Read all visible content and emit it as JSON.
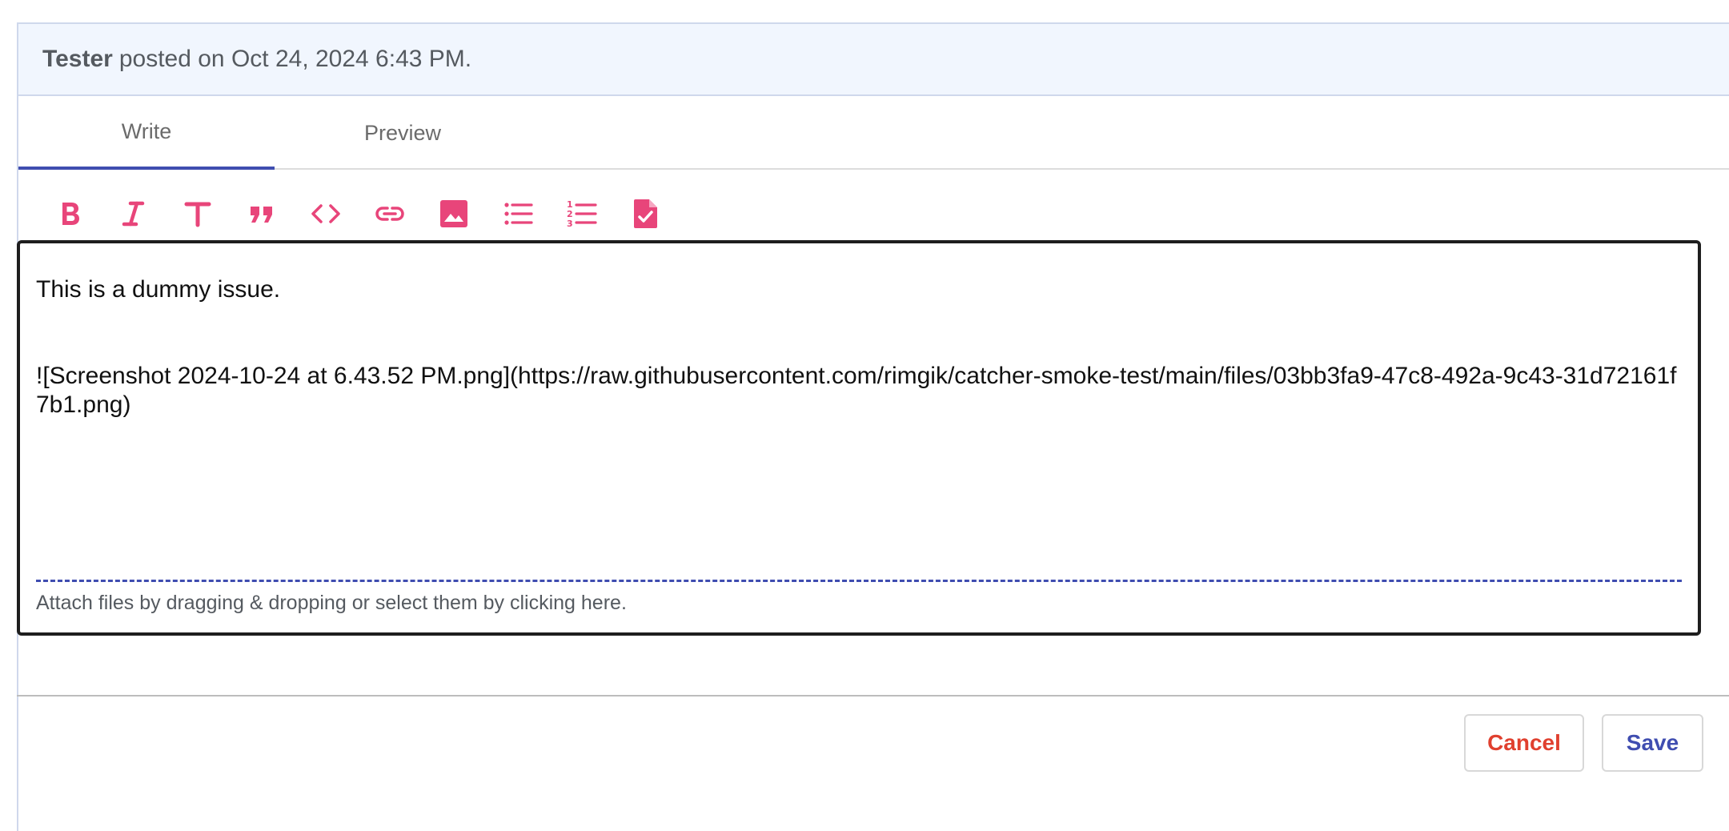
{
  "header": {
    "author": "Tester",
    "posted_text": "posted on Oct 24, 2024 6:43 PM."
  },
  "tabs": [
    {
      "label": "Write",
      "active": true
    },
    {
      "label": "Preview",
      "active": false
    }
  ],
  "toolbar": {
    "accent_color": "#e8457a",
    "icons": [
      "bold-icon",
      "italic-icon",
      "heading-icon",
      "quote-icon",
      "code-icon",
      "link-icon",
      "image-icon",
      "bulleted-list-icon",
      "numbered-list-icon",
      "task-list-icon"
    ]
  },
  "editor": {
    "line1": "This is a dummy issue.",
    "line2": "![Screenshot 2024-10-24 at 6.43.52 PM.png](https://raw.githubusercontent.com/rimgik/catcher-smoke-test/main/files/03bb3fa9-47c8-492a-9c43-31d72161f7b1.png)",
    "dropzone_text": "Attach files by dragging & dropping or select them by clicking here."
  },
  "actions": {
    "cancel_label": "Cancel",
    "save_label": "Save"
  },
  "colors": {
    "header_bg": "#f1f6fe",
    "tab_indicator": "#3f4db0",
    "cancel": "#e0402f",
    "save": "#3f4db0"
  }
}
